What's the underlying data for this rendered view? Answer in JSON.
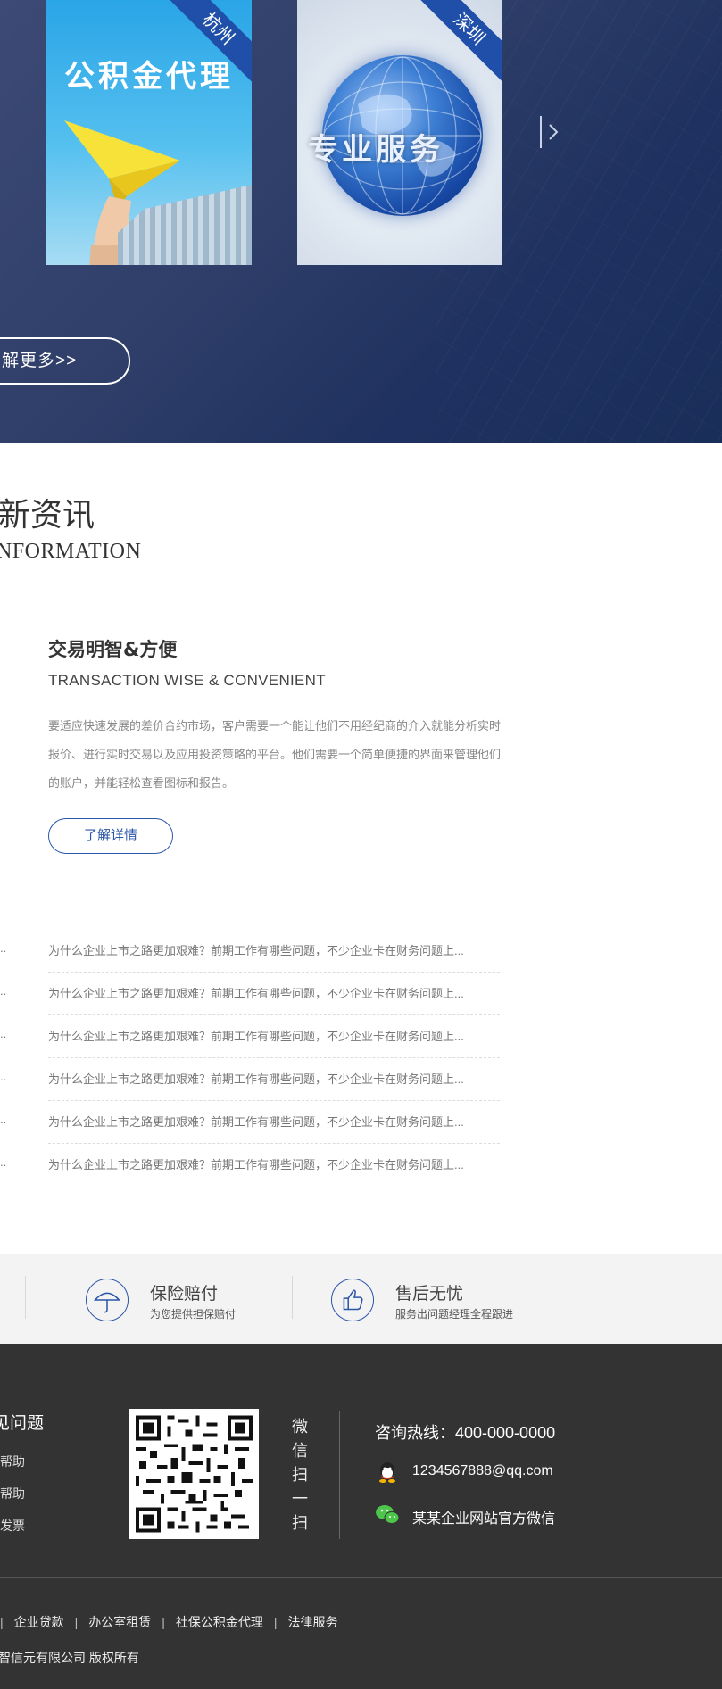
{
  "hero": {
    "cards": [
      {
        "city": "杭州",
        "title": "公积金代理"
      },
      {
        "city": "深圳",
        "title": "专业服务"
      }
    ],
    "next_arrow": "〉",
    "more_button": "解更多>>"
  },
  "news": {
    "title": "新资讯",
    "subtitle": "NFORMATION",
    "featured": {
      "title": "交易明智&方便",
      "title_en": "TRANSACTION WISE & CONVENIENT",
      "description": "要适应快速发展的差价合约市场，客户需要一个能让他们不用经纪商的介入就能分析实时报价、进行实时交易以及应用投资策略的平台。他们需要一个简单便捷的界面来管理他们的账户，并能轻松查看图标和报告。",
      "button": "了解详情"
    },
    "left_stubs": [
      "..",
      "..",
      "..",
      "..",
      "..",
      ".."
    ],
    "items": [
      "为什么企业上市之路更加艰难？前期工作有哪些问题，不少企业卡在财务问题上...",
      "为什么企业上市之路更加艰难？前期工作有哪些问题，不少企业卡在财务问题上...",
      "为什么企业上市之路更加艰难？前期工作有哪些问题，不少企业卡在财务问题上...",
      "为什么企业上市之路更加艰难？前期工作有哪些问题，不少企业卡在财务问题上...",
      "为什么企业上市之路更加艰难？前期工作有哪些问题，不少企业卡在财务问题上...",
      "为什么企业上市之路更加艰难？前期工作有哪些问题，不少企业卡在财务问题上..."
    ]
  },
  "services": [
    {
      "title": "保险赔付",
      "subtitle": "为您提供担保赔付",
      "icon": "umbrella-icon"
    },
    {
      "title": "售后无忧",
      "subtitle": "服务出问题经理全程跟进",
      "icon": "thumbs-up-icon"
    }
  ],
  "footer": {
    "faq_title": "见问题",
    "faq_items": [
      "帮助",
      "帮助",
      "发票"
    ],
    "qr_label": [
      "微",
      "信",
      "扫",
      "一",
      "扫"
    ],
    "hotline": "咨询热线：400-000-0000",
    "qq": "1234567888@qq.com",
    "wechat": "某某企业网站官方微信",
    "links": [
      "企业贷款",
      "办公室租赁",
      "社保公积金代理",
      "法律服务"
    ],
    "copyright": "智信元有限公司 版权所有"
  },
  "colors": {
    "accent": "#2b56a8",
    "hero_bg": "#2f3f69",
    "footer_bg": "#333333",
    "strip_bg": "#f3f3f3"
  }
}
